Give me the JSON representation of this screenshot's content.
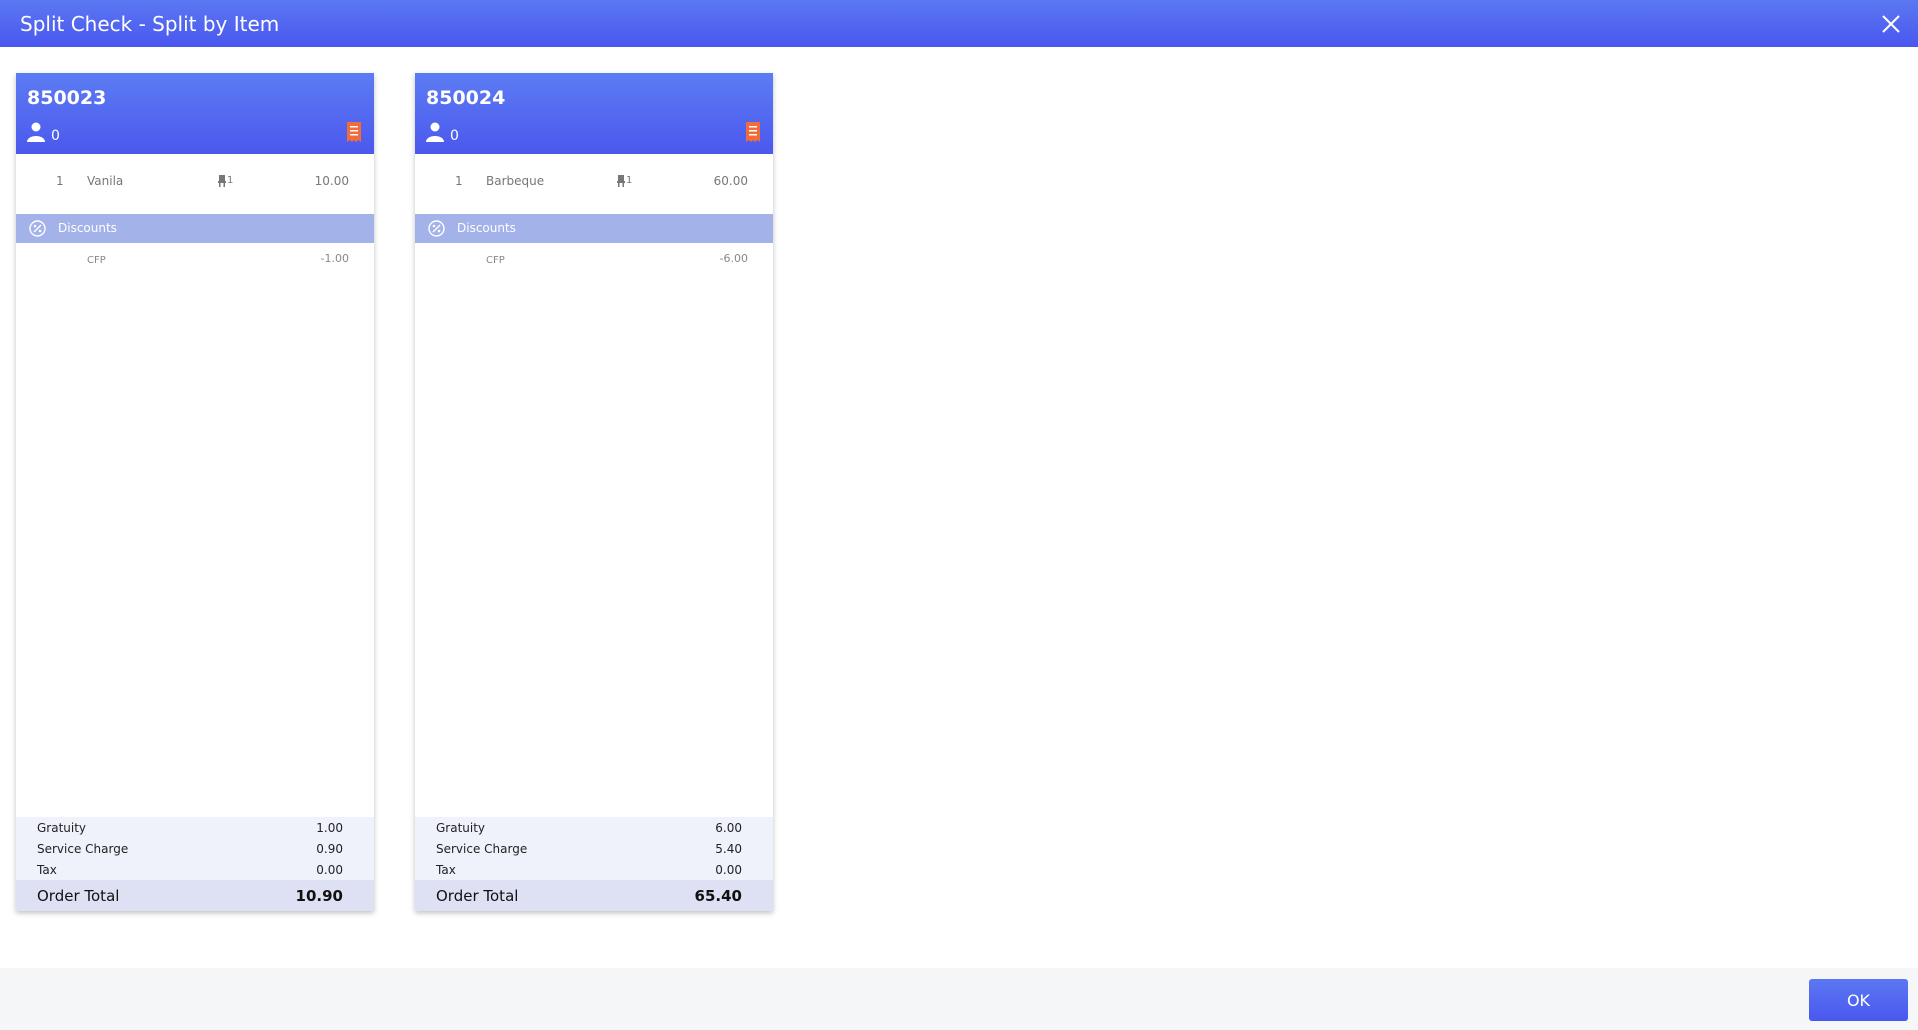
{
  "window": {
    "title": "Split Check - Split by Item"
  },
  "checks": [
    {
      "number": "850023",
      "guests": "0",
      "items": [
        {
          "qty": "1",
          "name": "Vanila",
          "seat": "1",
          "price": "10.00"
        }
      ],
      "discounts_label": "Discounts",
      "discounts": [
        {
          "name": "CFP",
          "value": "-1.00"
        }
      ],
      "summary": {
        "gratuity_label": "Gratuity",
        "gratuity": "1.00",
        "service_label": "Service Charge",
        "service": "0.90",
        "tax_label": "Tax",
        "tax": "0.00",
        "total_label": "Order Total",
        "total": "10.90"
      }
    },
    {
      "number": "850024",
      "guests": "0",
      "items": [
        {
          "qty": "1",
          "name": "Barbeque",
          "seat": "1",
          "price": "60.00"
        }
      ],
      "discounts_label": "Discounts",
      "discounts": [
        {
          "name": "CFP",
          "value": "-6.00"
        }
      ],
      "summary": {
        "gratuity_label": "Gratuity",
        "gratuity": "6.00",
        "service_label": "Service Charge",
        "service": "5.40",
        "tax_label": "Tax",
        "tax": "0.00",
        "total_label": "Order Total",
        "total": "65.40"
      }
    }
  ],
  "footer": {
    "ok_label": "OK"
  },
  "colors": {
    "header_blue": "#4b58ee",
    "discount_band": "#a3b2e8",
    "receipt_icon": "#f26b3a"
  },
  "icons": [
    "close-icon",
    "guest-icon",
    "receipt-icon",
    "seat-icon",
    "discount-icon"
  ]
}
